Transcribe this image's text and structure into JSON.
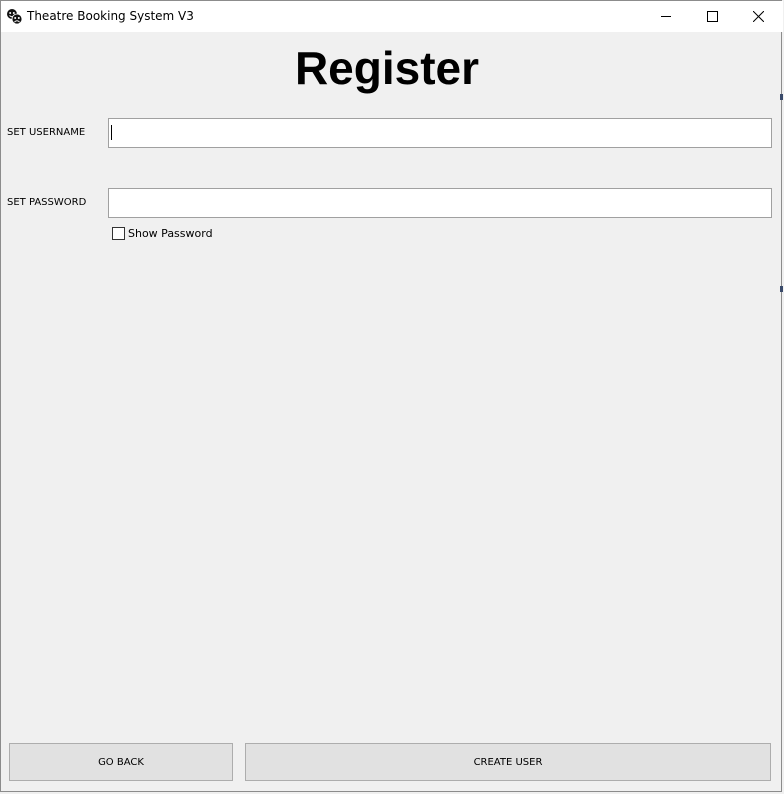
{
  "window": {
    "title": "Theatre Booking System V3",
    "controls": {
      "minimize": "minimize-icon",
      "maximize": "maximize-icon",
      "close": "close-icon"
    }
  },
  "page": {
    "heading": "Register"
  },
  "form": {
    "username_label": "SET USERNAME",
    "username_value": "",
    "password_label": "SET PASSWORD",
    "password_value": "",
    "show_password_label": "Show Password",
    "show_password_checked": false
  },
  "buttons": {
    "go_back": "GO BACK",
    "create_user": "CREATE USER"
  },
  "colors": {
    "titlebar": "#ffffff",
    "background": "#f0f0f0",
    "button_face": "#e1e1e1",
    "field_border": "#a0a0a0"
  }
}
